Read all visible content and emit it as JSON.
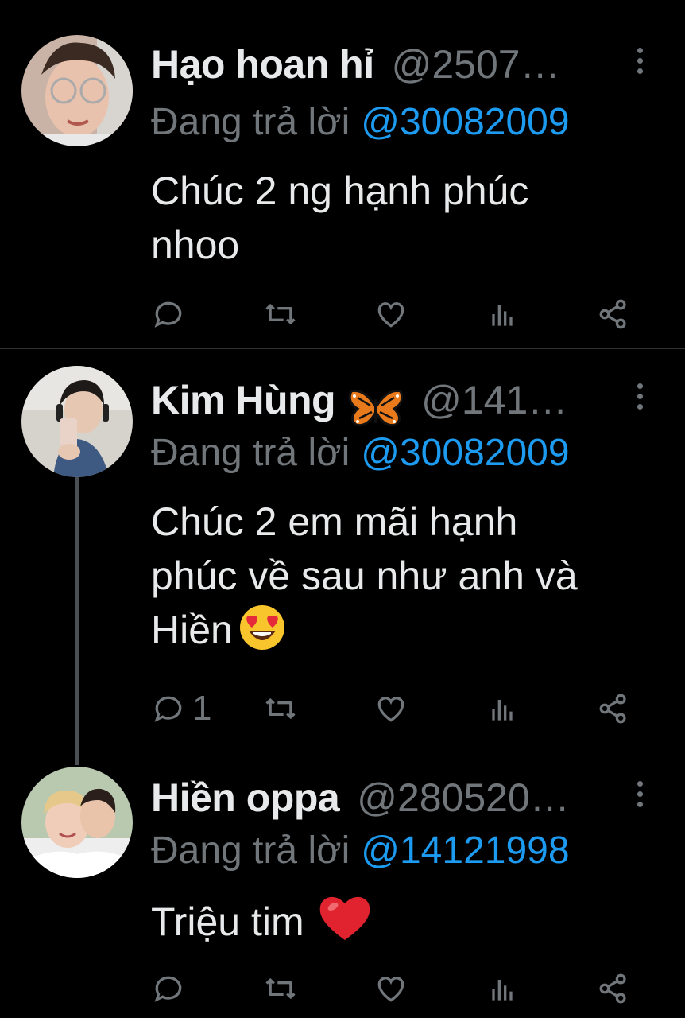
{
  "tweets": [
    {
      "name": "Hạo hoan hỉ",
      "handle": "@2507…",
      "reply_prefix": "Đang trả lời",
      "reply_to": "@30082009",
      "text_line1": "Chúc 2 ng hạnh phúc",
      "text_line2": "nhoo",
      "text_line3": "",
      "reply_count": ""
    },
    {
      "name": "Kim Hùng",
      "badge_icon": "butterfly-icon",
      "handle": "@141…",
      "reply_prefix": "Đang trả lời",
      "reply_to": "@30082009",
      "text_line1": "Chúc 2 em mãi hạnh",
      "text_line2": "phúc về sau như anh và",
      "text_line3": "Hiền",
      "text_emoji": "heart-eyes-emoji",
      "reply_count": "1"
    },
    {
      "name": "Hiền oppa",
      "handle": "@280520…",
      "reply_prefix": "Đang trả lời",
      "reply_to": "@14121998",
      "text_line1": "Triệu tim",
      "text_emoji": "red-heart-emoji",
      "reply_count": ""
    }
  ],
  "colors": {
    "background": "#000000",
    "text": "#e7e9ea",
    "muted": "#71767b",
    "mention": "#1d9bf0",
    "divider": "#2f3336"
  },
  "action_icons": [
    "reply-icon",
    "retweet-icon",
    "like-icon",
    "views-icon",
    "share-icon"
  ]
}
